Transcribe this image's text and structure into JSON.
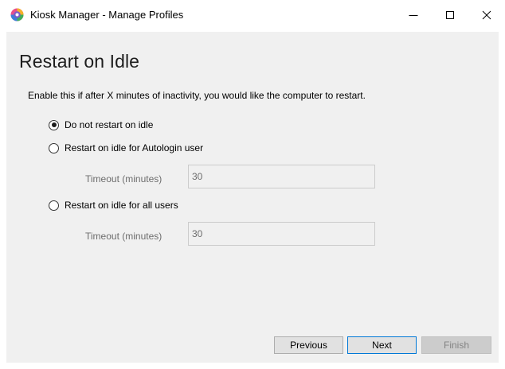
{
  "window": {
    "title": "Kiosk Manager - Manage Profiles",
    "icon": "kiosk-manager-app-icon",
    "caption_buttons": [
      "minimize",
      "maximize",
      "close"
    ]
  },
  "page": {
    "title": "Restart on Idle",
    "description": "Enable this if after X minutes of inactivity, you would like the computer to restart."
  },
  "options": [
    {
      "label": "Do not restart on idle",
      "checked": true
    },
    {
      "label": "Restart on idle for Autologin user",
      "checked": false
    },
    {
      "label": "Restart on idle for all users",
      "checked": false
    }
  ],
  "autologin_timeout": {
    "label": "Timeout (minutes)",
    "value": "30",
    "enabled": false
  },
  "all_users_timeout": {
    "label": "Timeout (minutes)",
    "value": "30",
    "enabled": false
  },
  "buttons": {
    "previous": "Previous",
    "next": "Next",
    "finish": "Finish",
    "finish_enabled": false
  },
  "colors": {
    "content_background": "#f0f0f0",
    "title_bar_background": "#ffffff",
    "default_button_border": "#0078d7",
    "disabled_text": "#838383"
  }
}
